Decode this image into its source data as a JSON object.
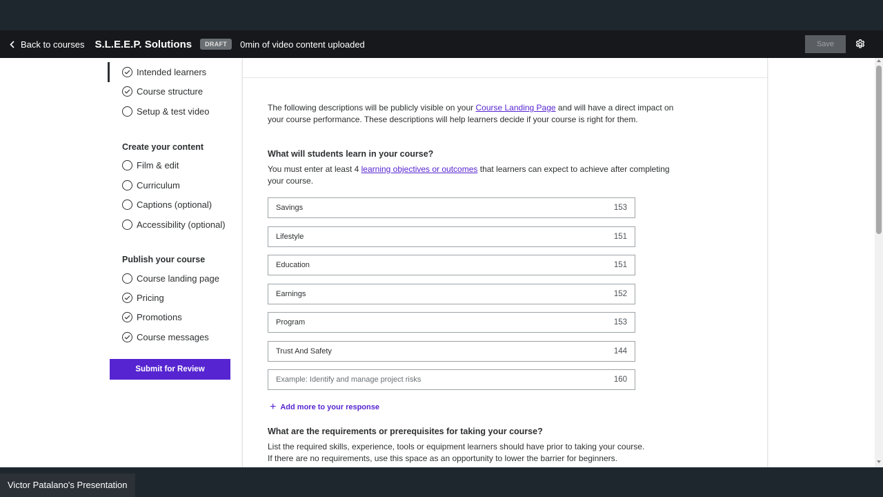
{
  "header": {
    "back_label": "Back to courses",
    "course_title": "S.L.E.E.P. Solutions",
    "status_badge": "DRAFT",
    "upload_status": "0min of video content uploaded",
    "save_label": "Save"
  },
  "sidebar": {
    "plan_items": [
      {
        "label": "Intended learners",
        "checked": true
      },
      {
        "label": "Course structure",
        "checked": true
      },
      {
        "label": "Setup & test video",
        "checked": false
      }
    ],
    "create_heading": "Create your content",
    "create_items": [
      {
        "label": "Film & edit",
        "checked": false
      },
      {
        "label": "Curriculum",
        "checked": false
      },
      {
        "label": "Captions (optional)",
        "checked": false
      },
      {
        "label": "Accessibility (optional)",
        "checked": false
      }
    ],
    "publish_heading": "Publish your course",
    "publish_items": [
      {
        "label": "Course landing page",
        "checked": false
      },
      {
        "label": "Pricing",
        "checked": true
      },
      {
        "label": "Promotions",
        "checked": true
      },
      {
        "label": "Course messages",
        "checked": true
      }
    ],
    "submit_label": "Submit for Review"
  },
  "main": {
    "intro_before": "The following descriptions will be publicly visible on your ",
    "intro_link": "Course Landing Page",
    "intro_after": " and will have a direct impact on your course performance. These descriptions will help learners decide if your course is right for them.",
    "q1_title": "What will students learn in your course?",
    "q1_desc_before": "You must enter at least 4 ",
    "q1_desc_link": "learning objectives or outcomes",
    "q1_desc_after": " that learners can expect to achieve after completing your course.",
    "objectives": [
      {
        "value": "Savings",
        "count": "153"
      },
      {
        "value": "Lifestyle",
        "count": "151"
      },
      {
        "value": "Education",
        "count": "151"
      },
      {
        "value": "Earnings",
        "count": "152"
      },
      {
        "value": "Program",
        "count": "153"
      },
      {
        "value": "Trust And Safety",
        "count": "144"
      }
    ],
    "empty_objective": {
      "placeholder": "Example: Identify and manage project risks",
      "count": "160"
    },
    "add_more_label": "Add more to your response",
    "q2_title": "What are the requirements or prerequisites for taking your course?",
    "q2_desc_line1": "List the required skills, experience, tools or equipment learners should have prior to taking your course.",
    "q2_desc_line2": "If there are no requirements, use this space as an opportunity to lower the barrier for beginners."
  },
  "presentation": {
    "presenter_label": "Victor Patalano's Presentation"
  },
  "colors": {
    "accent": "#5624d0",
    "header_bg": "#16181b",
    "chrome_bg": "#1f272e"
  }
}
